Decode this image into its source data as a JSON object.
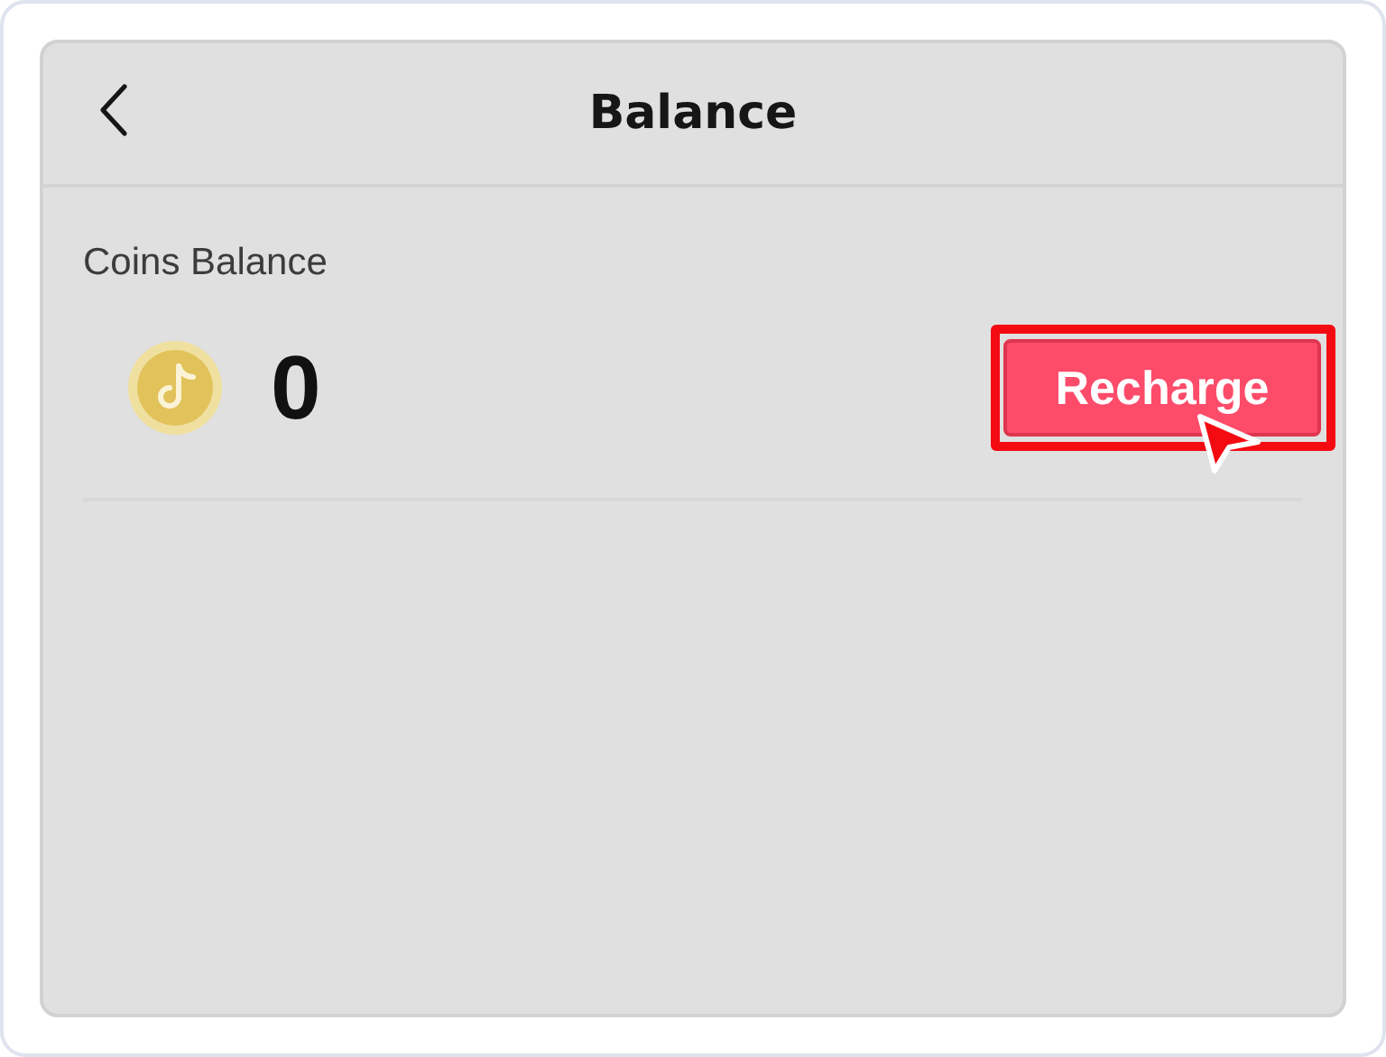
{
  "header": {
    "title": "Balance"
  },
  "balance": {
    "label": "Coins Balance",
    "amount": "0"
  },
  "recharge_button": {
    "label": "Recharge",
    "highlighted": true
  }
}
